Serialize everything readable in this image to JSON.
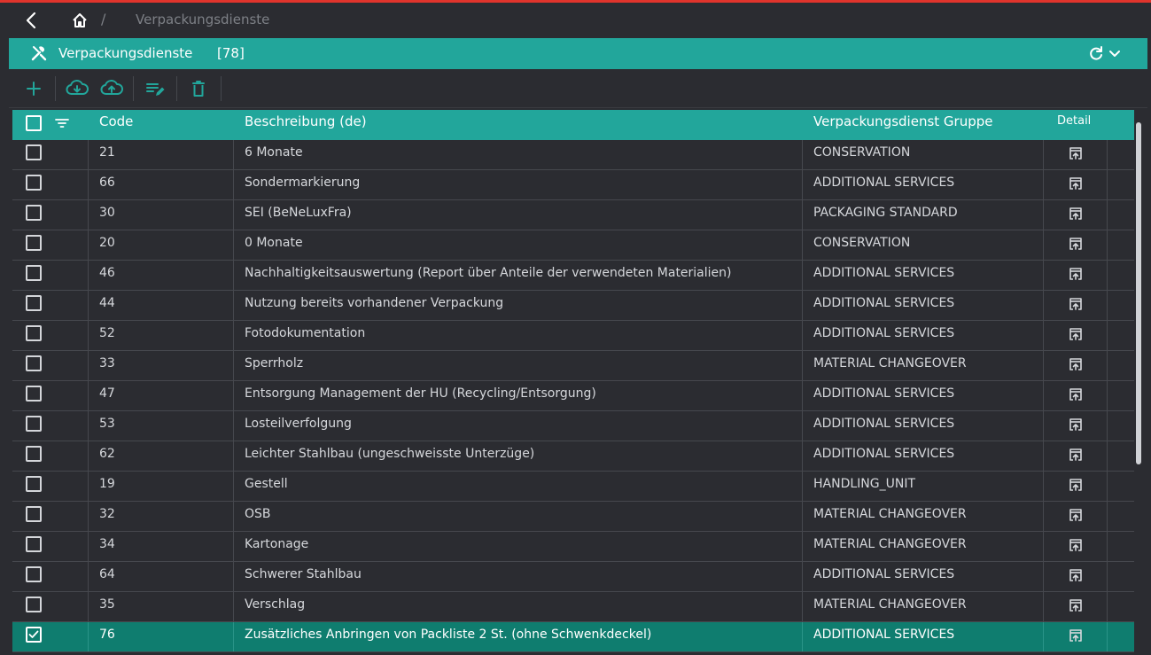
{
  "breadcrumb": {
    "back_icon": "chevron-left-icon",
    "home_icon": "home-icon",
    "separator": "/",
    "current": "Verpackungsdienste"
  },
  "panel": {
    "icon": "tools-icon",
    "title": "Verpackungsdienste",
    "count": "[78]",
    "refresh_icon": "refresh-icon",
    "collapse_icon": "chevron-down-icon"
  },
  "toolbar": {
    "buttons": [
      "add-icon",
      "cloud-download-icon",
      "cloud-upload-icon",
      "edit-list-icon",
      "delete-icon"
    ]
  },
  "table": {
    "columns": {
      "code": "Code",
      "description": "Beschreibung (de)",
      "group": "Verpackungsdienst Gruppe",
      "detail": "Detail"
    },
    "rows": [
      {
        "code": "21",
        "description": "6 Monate",
        "group": "CONSERVATION",
        "checked": false
      },
      {
        "code": "66",
        "description": "Sondermarkierung",
        "group": "ADDITIONAL SERVICES",
        "checked": false
      },
      {
        "code": "30",
        "description": "SEI (BeNeLuxFra)",
        "group": "PACKAGING STANDARD",
        "checked": false
      },
      {
        "code": "20",
        "description": "0 Monate",
        "group": "CONSERVATION",
        "checked": false
      },
      {
        "code": "46",
        "description": "Nachhaltigkeitsauswertung (Report über Anteile der verwendeten Materialien)",
        "group": "ADDITIONAL SERVICES",
        "checked": false
      },
      {
        "code": "44",
        "description": "Nutzung bereits vorhandener Verpackung",
        "group": "ADDITIONAL SERVICES",
        "checked": false
      },
      {
        "code": "52",
        "description": "Fotodokumentation",
        "group": "ADDITIONAL SERVICES",
        "checked": false
      },
      {
        "code": "33",
        "description": "Sperrholz",
        "group": "MATERIAL CHANGEOVER",
        "checked": false
      },
      {
        "code": "47",
        "description": "Entsorgung Management der HU (Recycling/Entsorgung)",
        "group": "ADDITIONAL SERVICES",
        "checked": false
      },
      {
        "code": "53",
        "description": "Losteilverfolgung",
        "group": "ADDITIONAL SERVICES",
        "checked": false
      },
      {
        "code": "62",
        "description": "Leichter Stahlbau (ungeschweisste Unterzüge)",
        "group": "ADDITIONAL SERVICES",
        "checked": false
      },
      {
        "code": "19",
        "description": "Gestell",
        "group": "HANDLING_UNIT",
        "checked": false
      },
      {
        "code": "32",
        "description": "OSB",
        "group": "MATERIAL CHANGEOVER",
        "checked": false
      },
      {
        "code": "34",
        "description": "Kartonage",
        "group": "MATERIAL CHANGEOVER",
        "checked": false
      },
      {
        "code": "64",
        "description": "Schwerer Stahlbau",
        "group": "ADDITIONAL SERVICES",
        "checked": false
      },
      {
        "code": "35",
        "description": "Verschlag",
        "group": "MATERIAL CHANGEOVER",
        "checked": false
      },
      {
        "code": "76",
        "description": "Zusätzliches Anbringen von Packliste 2 St. (ohne Schwenkdeckel)",
        "group": "ADDITIONAL SERVICES",
        "checked": true
      }
    ]
  },
  "colors": {
    "accent": "#22a69b",
    "selected_row": "#0f7d6f",
    "background": "#2b2c31",
    "top_line": "#e0342c"
  }
}
